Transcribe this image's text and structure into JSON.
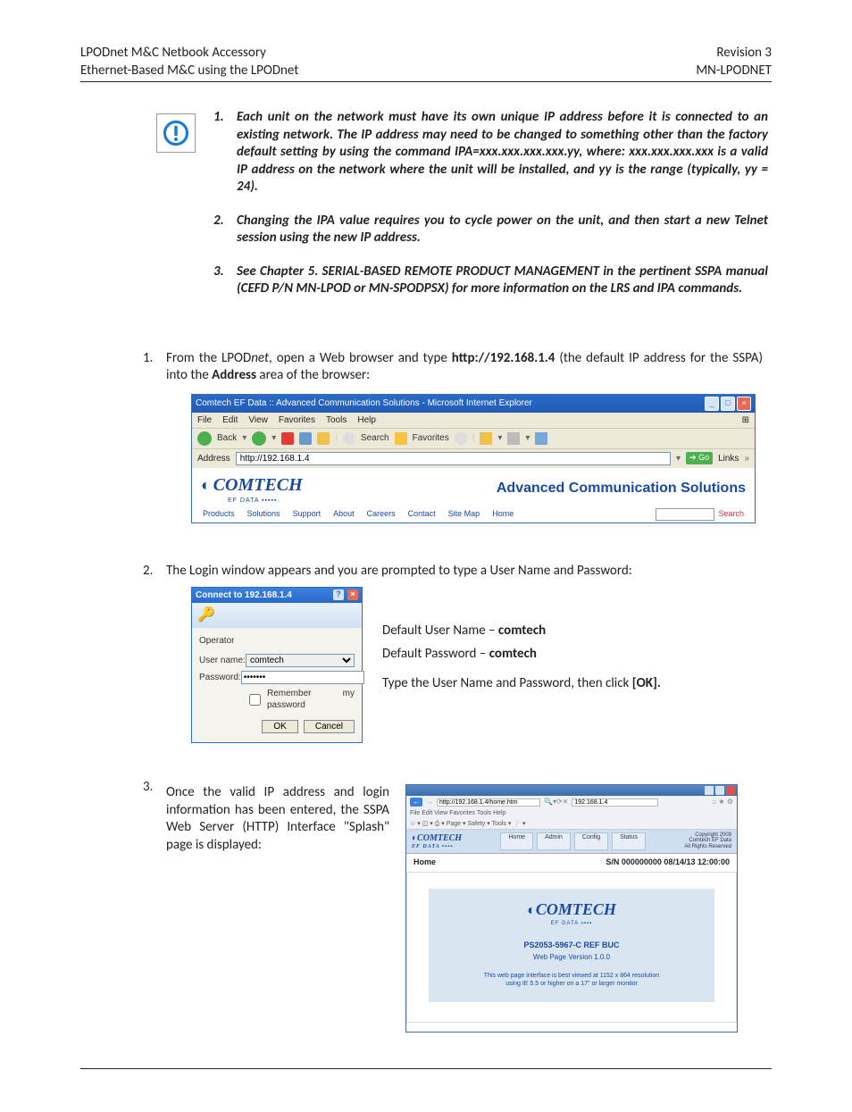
{
  "header": {
    "left1": "LPODnet M&C Netbook Accessory",
    "left2": "Ethernet-Based M&C using the LPODnet",
    "right1": "Revision 3",
    "right2": "MN-LPODNET"
  },
  "alerts": {
    "n1": "1.",
    "t1": "Each unit on the network must have its own unique IP address before it is connected to an existing network. The IP address may need to be changed to something other than the factory default setting by using the command IPA=xxx.xxx.xxx.xxx.yy, where: xxx.xxx.xxx.xxx is a valid IP address on the network where the unit will be installed, and yy is the range (typically, yy = 24).",
    "n2": "2.",
    "t2": "Changing the IPA value requires you to cycle power on the unit, and then start a new Telnet session using the new IP address.",
    "n3": "3.",
    "t3": "See Chapter 5. SERIAL-BASED REMOTE PRODUCT MANAGEMENT in the pertinent SSPA manual (CEFD P/N MN-LPOD or MN-SPODPSX) for more information on the LRS and IPA commands."
  },
  "step1": {
    "num": "1.",
    "pre": "From the LPOD",
    "net": "net",
    "mid": ", open a Web browser and type ",
    "url": "http://192.168.1.4",
    "mid2": "  (the default IP address for the SSPA) into the ",
    "addr": "Address",
    "post": " area of the browser:"
  },
  "ie": {
    "title": "Comtech EF Data :: Advanced Communication Solutions - Microsoft Internet Explorer",
    "menus": {
      "file": "File",
      "edit": "Edit",
      "view": "View",
      "fav": "Favorites",
      "tools": "Tools",
      "help": "Help"
    },
    "toolbar": {
      "back": "Back",
      "search": "Search",
      "favorites": "Favorites"
    },
    "addr_label": "Address",
    "addr_value": "http://192.168.1.4",
    "go": "Go",
    "links": "Links",
    "logo_top": "COMTECH",
    "logo_sub": "EF DATA ▪▪▪▪▪.",
    "tagline": "Advanced Communication Solutions",
    "nav": {
      "products": "Products",
      "solutions": "Solutions",
      "support": "Support",
      "about": "About",
      "careers": "Careers",
      "contact": "Contact",
      "sitemap": "Site Map",
      "home": "Home",
      "search": "Search"
    }
  },
  "step2": {
    "num": "2.",
    "text": "The Login window appears and you are prompted to type a User Name and Password:",
    "login": {
      "title": "Connect to 192.168.1.4",
      "section": "Operator",
      "user_lbl": "User name:",
      "user_val": "comtech",
      "pass_lbl": "Password:",
      "pass_val": "•••••••",
      "remember": "Remember my password",
      "ok": "OK",
      "cancel": "Cancel"
    },
    "side": {
      "l1a": "Default User Name – ",
      "l1b": "comtech",
      "l2a": "Default Password – ",
      "l2b": "comtech",
      "l3a": "Type the User Name and Password, then click ",
      "l3b": "[OK]."
    }
  },
  "step3": {
    "num": "3.",
    "text": "Once the valid IP address and login information has been entered, the SSPA Web Server (HTTP) Interface \"Splash\" page is displayed:",
    "splash": {
      "addr": "http://192.168.1.4/home.htm",
      "addr2": "192.168.1.4",
      "menu": "File   Edit   View   Favorites   Tools   Help",
      "menu2": "☆ ▾ ◫ ▾ ⎙ ▾ Page ▾ Safety ▾ Tools ▾ ❔ ▾ ",
      "tabs": {
        "home": "Home",
        "admin": "Admin",
        "config": "Config",
        "status": "Status"
      },
      "copy": "Copyright 2009\nComtech EF Data\nAll Rights Reserved",
      "home": "Home",
      "serial": "S/N 000000000 08/14/13 12:00:00",
      "logo": "COMTECH",
      "logo_sub": "EF DATA ▪▪▪▪",
      "model": "PS2053-5967-C REF BUC",
      "ver": "Web Page Version 1.0.0",
      "note": "This web page interface is best viewed at 1152 x 864 resolution\nusing IE 5.5 or higher on a 17\" or larger monitor"
    }
  }
}
